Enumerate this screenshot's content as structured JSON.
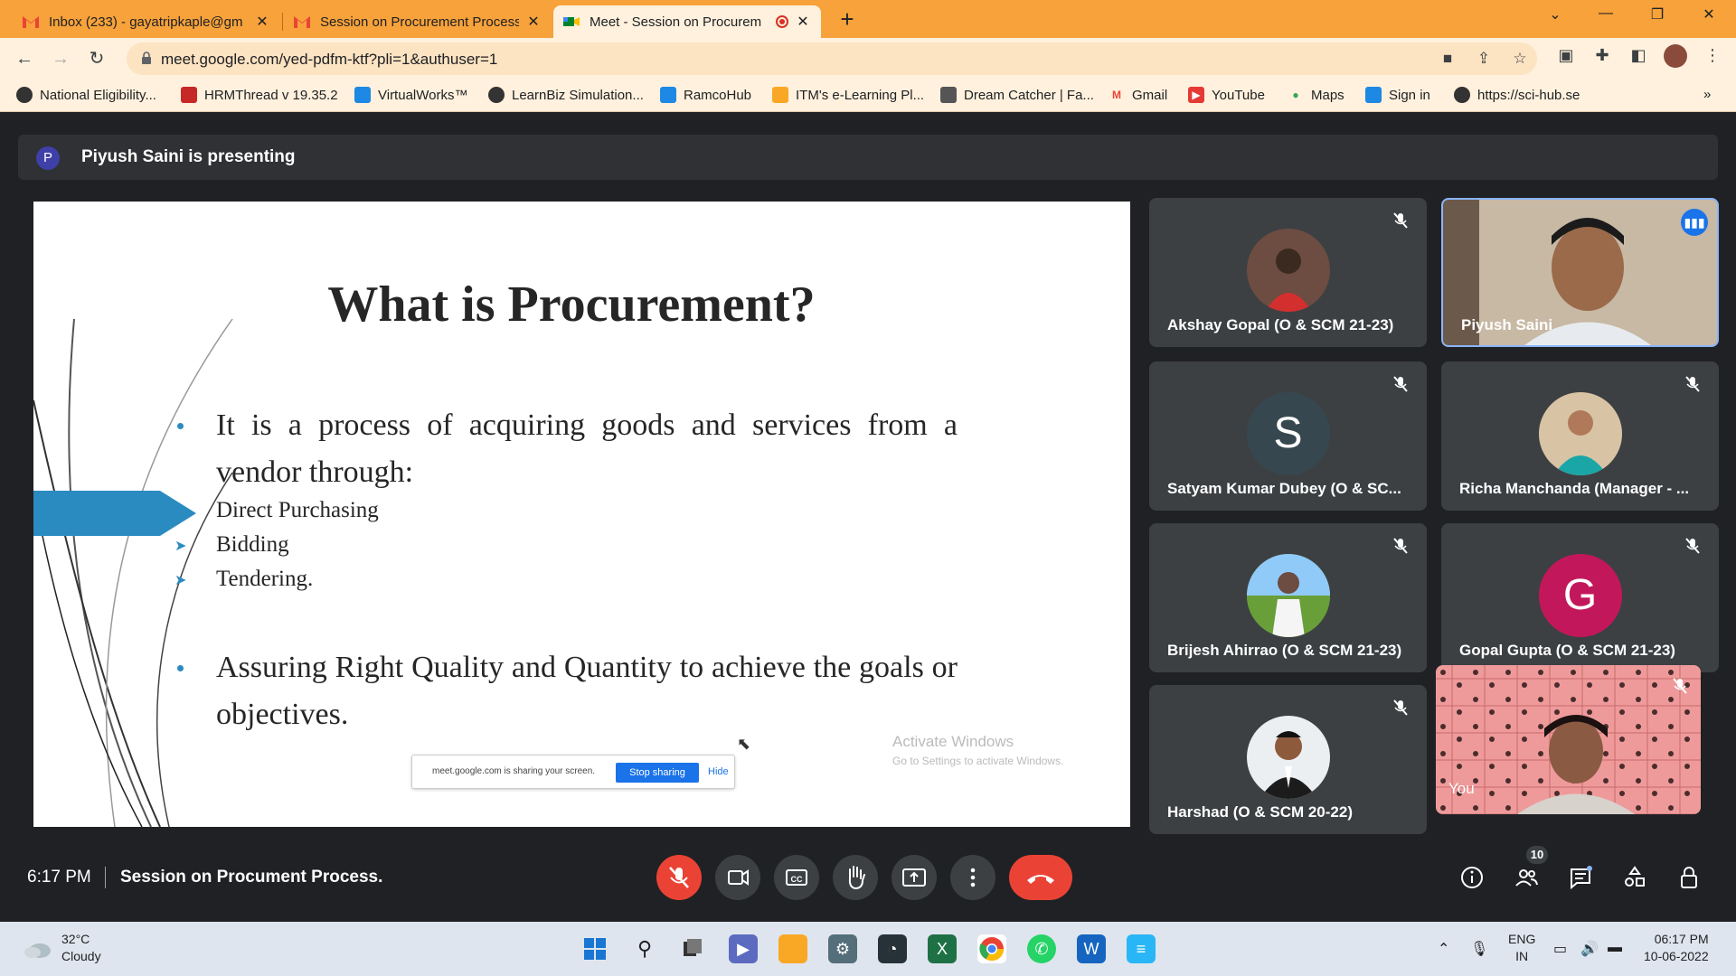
{
  "browser": {
    "tabs": [
      {
        "title": "Inbox (233) - gayatripkaple@gm",
        "close": "✕"
      },
      {
        "title": "Session on Procurement Process",
        "close": "✕"
      },
      {
        "title": "Meet - Session on Procurem",
        "close": "✕"
      }
    ],
    "new_tab": "+",
    "window_controls": [
      "⌄",
      "—",
      "❐",
      "✕"
    ],
    "url": "meet.google.com/yed-pdfm-ktf?pli=1&authuser=1",
    "bookmarks": [
      "National Eligibility...",
      "HRMThread v 19.35.2",
      "VirtualWorks™",
      "LearnBiz Simulation...",
      "RamcoHub",
      "ITM's e-Learning Pl...",
      "Dream Catcher | Fa...",
      "Gmail",
      "YouTube",
      "Maps",
      "Sign in",
      "https://sci-hub.se"
    ],
    "bookmarks_more": "»"
  },
  "meet": {
    "presenter_initial": "P",
    "presenting_text": "Piyush Saini is presenting",
    "slide": {
      "title": "What is Procurement?",
      "bullet1": "It is a process of acquiring goods and services from a vendor through:",
      "sub_items": [
        "Direct Purchasing",
        "Bidding",
        "Tendering."
      ],
      "bullet2": "Assuring Right Quality and Quantity to achieve the goals or objectives."
    },
    "share_bar": {
      "text": "meet.google.com is sharing your screen.",
      "stop": "Stop sharing",
      "hide": "Hide"
    },
    "activate_windows": {
      "line1": "Activate Windows",
      "line2": "Go to Settings to activate Windows."
    },
    "participants": [
      {
        "name": "Akshay Gopal (O & SCM 21-23)",
        "initial": ""
      },
      {
        "name": "Piyush Saini",
        "initial": ""
      },
      {
        "name": "Satyam Kumar Dubey (O & SC...",
        "initial": "S"
      },
      {
        "name": "Richa Manchanda (Manager - ...",
        "initial": ""
      },
      {
        "name": "Brijesh Ahirrao (O & SCM 21-23)",
        "initial": ""
      },
      {
        "name": "Gopal Gupta (O & SCM 21-23)",
        "initial": "G"
      },
      {
        "name": "Harshad (O & SCM 20-22)",
        "initial": ""
      },
      {
        "name": "You",
        "initial": ""
      }
    ],
    "controls": {
      "time": "6:17 PM",
      "meeting_title": "Session on Procument Process.",
      "participant_count": "10"
    }
  },
  "taskbar": {
    "temp": "32°C",
    "condition": "Cloudy",
    "lang1": "ENG",
    "lang2": "IN",
    "time": "06:17 PM",
    "date": "10-06-2022"
  },
  "colors": {
    "tab_strip": "#f7a23a",
    "meet_bg": "#202124",
    "tile_bg": "#3c4043",
    "hangup": "#ea4335",
    "slide_accent": "#2a8bc0"
  }
}
